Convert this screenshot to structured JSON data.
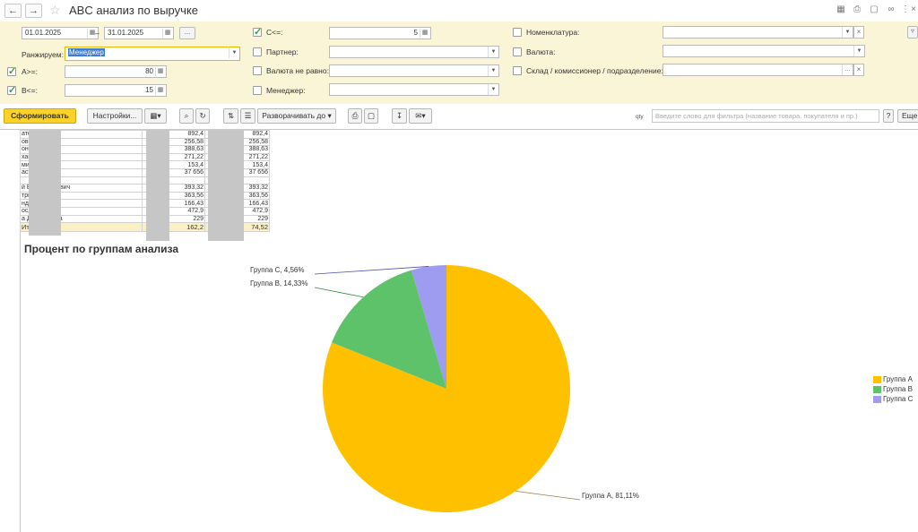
{
  "window": {
    "title": "ABC анализ по выручке",
    "back_icon": "←",
    "forward_icon": "→",
    "star_icon": "☆"
  },
  "filters": {
    "date_from": "01.01.2025",
    "date_sep": "–",
    "date_to": "31.01.2025",
    "dots_label": "...",
    "rank_label": "Ранжируем:",
    "rank_value": "Менеджер",
    "a_label": "A>=:",
    "a_value": "80",
    "a_checked": true,
    "b_label": "B<=:",
    "b_value": "15",
    "b_checked": true,
    "c_label": "C<=:",
    "c_value": "5",
    "c_checked": true,
    "partner_label": "Партнер:",
    "currency_ne_label": "Валюта не равно:",
    "manager_label": "Менеджер:",
    "nomenclature_label": "Номенклатура:",
    "currency_label": "Валюта:",
    "warehouse_label": "Склад / комиссионер  / подразделение:"
  },
  "toolbar": {
    "generate_label": "Сформировать",
    "settings_label": "Настройки...",
    "expand_label": "Разворачивать до",
    "qty_label": "qty",
    "search_placeholder": "Введите слово для фильтра (название товара, покупателя и пр.)",
    "help_label": "?",
    "more_label": "Еще"
  },
  "table": {
    "rows": [
      {
        "name": "атовна",
        "v1": "892,4",
        "v2": "892,4"
      },
      {
        "name": "ович",
        "v1": "256,58",
        "v2": "256,58"
      },
      {
        "name": "онидович",
        "v1": "388,63",
        "v2": "388,63"
      },
      {
        "name": "хайловна",
        "v1": "271,22",
        "v2": "271,22"
      },
      {
        "name": "мирович",
        "v1": "153,4",
        "v2": "153,4"
      },
      {
        "name": "астасия",
        "v1": "37 656",
        "v2": "37 656"
      },
      {
        "name": "",
        "v1": "",
        "v2": ""
      },
      {
        "name": "й Владимирович",
        "v1": "393,32",
        "v2": "393,32"
      },
      {
        "name": "трьевна",
        "v1": "363,56",
        "v2": "363,56"
      },
      {
        "name": "ндреевна",
        "v1": "166,43",
        "v2": "166,43"
      },
      {
        "name": "ославовна",
        "v1": "472,9",
        "v2": "472,9"
      },
      {
        "name": "а Дмитриевна",
        "v1": "229",
        "v2": "229"
      }
    ],
    "total_label": "Итого",
    "total_v1": "162,2",
    "total_v2": "74,52"
  },
  "chart_data": {
    "type": "pie",
    "title": "Процент по группам анализа",
    "labels": [
      "Группа A",
      "Группа B",
      "Группа C"
    ],
    "values": [
      81.11,
      14.33,
      4.56
    ],
    "colors": [
      "#ffc000",
      "#5ec26a",
      "#9e9cf0"
    ],
    "slice_labels": [
      "Группа A, 81,11%",
      "Группа B, 14,33%",
      "Группа C, 4,56%"
    ],
    "legend_position": "right"
  }
}
